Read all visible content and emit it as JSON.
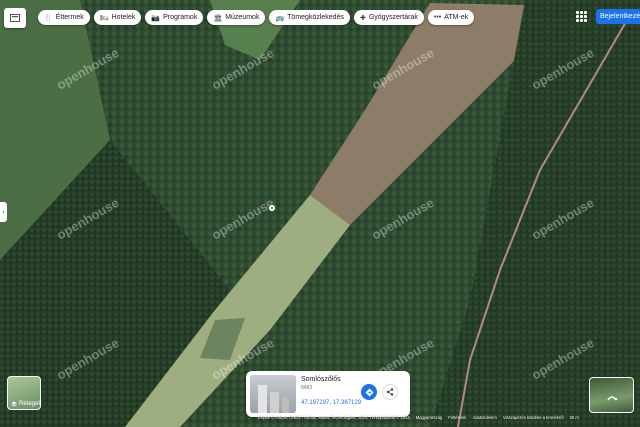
{
  "toolbar": {
    "chips": [
      {
        "icon": "restaurant-icon",
        "glyph": "🍴",
        "label": "Éttermek"
      },
      {
        "icon": "hotel-icon",
        "glyph": "🛏",
        "label": "Hotelek"
      },
      {
        "icon": "camera-icon",
        "glyph": "📷",
        "label": "Programok"
      },
      {
        "icon": "museum-icon",
        "glyph": "🏛",
        "label": "Múzeumok"
      },
      {
        "icon": "transit-icon",
        "glyph": "🚌",
        "label": "Tömegközlekedés"
      },
      {
        "icon": "pharmacy-icon",
        "glyph": "✚",
        "label": "Gyógyszertárak"
      },
      {
        "icon": "atm-icon",
        "glyph": "•••",
        "label": "ATM-ek"
      }
    ],
    "signin_label": "Bejelentkezés"
  },
  "watermark": "openhouse",
  "layers": {
    "label": "Rétegek"
  },
  "place_card": {
    "title": "Somlószőlős",
    "subtitle": "8483",
    "coords": "47.197297, 17.387129"
  },
  "footer": {
    "attribution": "Képek © Airbus, CNES / Airbus, Maxar Technologies, 2024, Térképadatok © 2024",
    "links": [
      "Magyarország",
      "Feltételek",
      "Adatvédelem",
      "Visszajelzés küldése a termékről",
      "50 m"
    ]
  },
  "colors": {
    "accent": "#1a73e8"
  }
}
